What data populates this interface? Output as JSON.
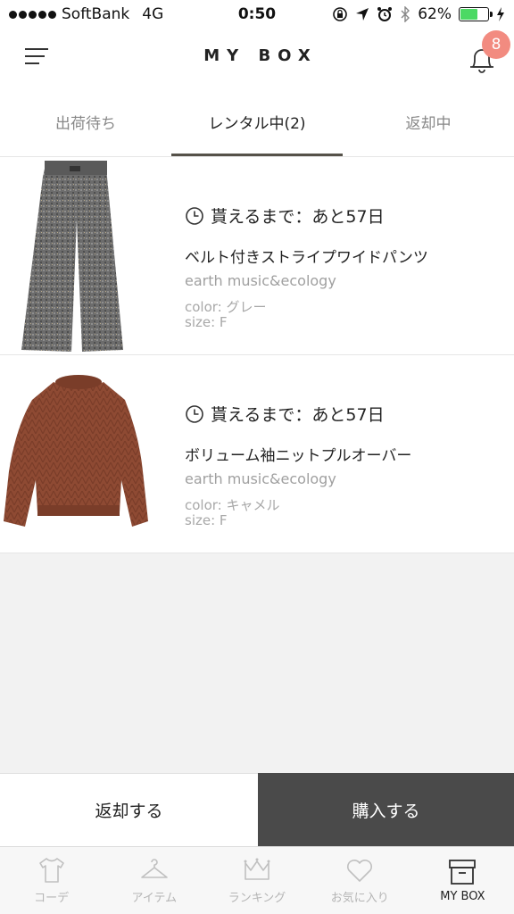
{
  "status_bar": {
    "carrier": "SoftBank",
    "network": "4G",
    "time": "0:50",
    "battery_percent": "62%",
    "battery_level": 0.62
  },
  "header": {
    "title": "MY BOX",
    "notification_count": "8"
  },
  "tabs": [
    {
      "label": "出荷待ち",
      "active": false
    },
    {
      "label": "レンタル中(2)",
      "active": true
    },
    {
      "label": "返却中",
      "active": false
    }
  ],
  "items": [
    {
      "countdown": "貰えるまで：あと57日",
      "name": "ベルト付きストライプワイドパンツ",
      "brand": "earth music&ecology",
      "color": "color: グレー",
      "size": "size: F",
      "image_icon": "wide-pants-image"
    },
    {
      "countdown": "貰えるまで：あと57日",
      "name": "ボリューム袖ニットプルオーバー",
      "brand": "earth music&ecology",
      "color": "color: キャメル",
      "size": "size: F",
      "image_icon": "knit-pullover-image"
    }
  ],
  "actions": {
    "return_label": "返却する",
    "buy_label": "購入する"
  },
  "bottom_nav": [
    {
      "label": "コーデ",
      "icon": "tshirt-icon",
      "active": false
    },
    {
      "label": "アイテム",
      "icon": "hanger-icon",
      "active": false
    },
    {
      "label": "ランキング",
      "icon": "crown-icon",
      "active": false
    },
    {
      "label": "お気に入り",
      "icon": "heart-icon",
      "active": false
    },
    {
      "label": "MY BOX",
      "icon": "box-icon",
      "active": true
    }
  ],
  "colors": {
    "accent_dark": "#4a4a4a",
    "badge": "#f28b80",
    "battery": "#4cd964"
  }
}
